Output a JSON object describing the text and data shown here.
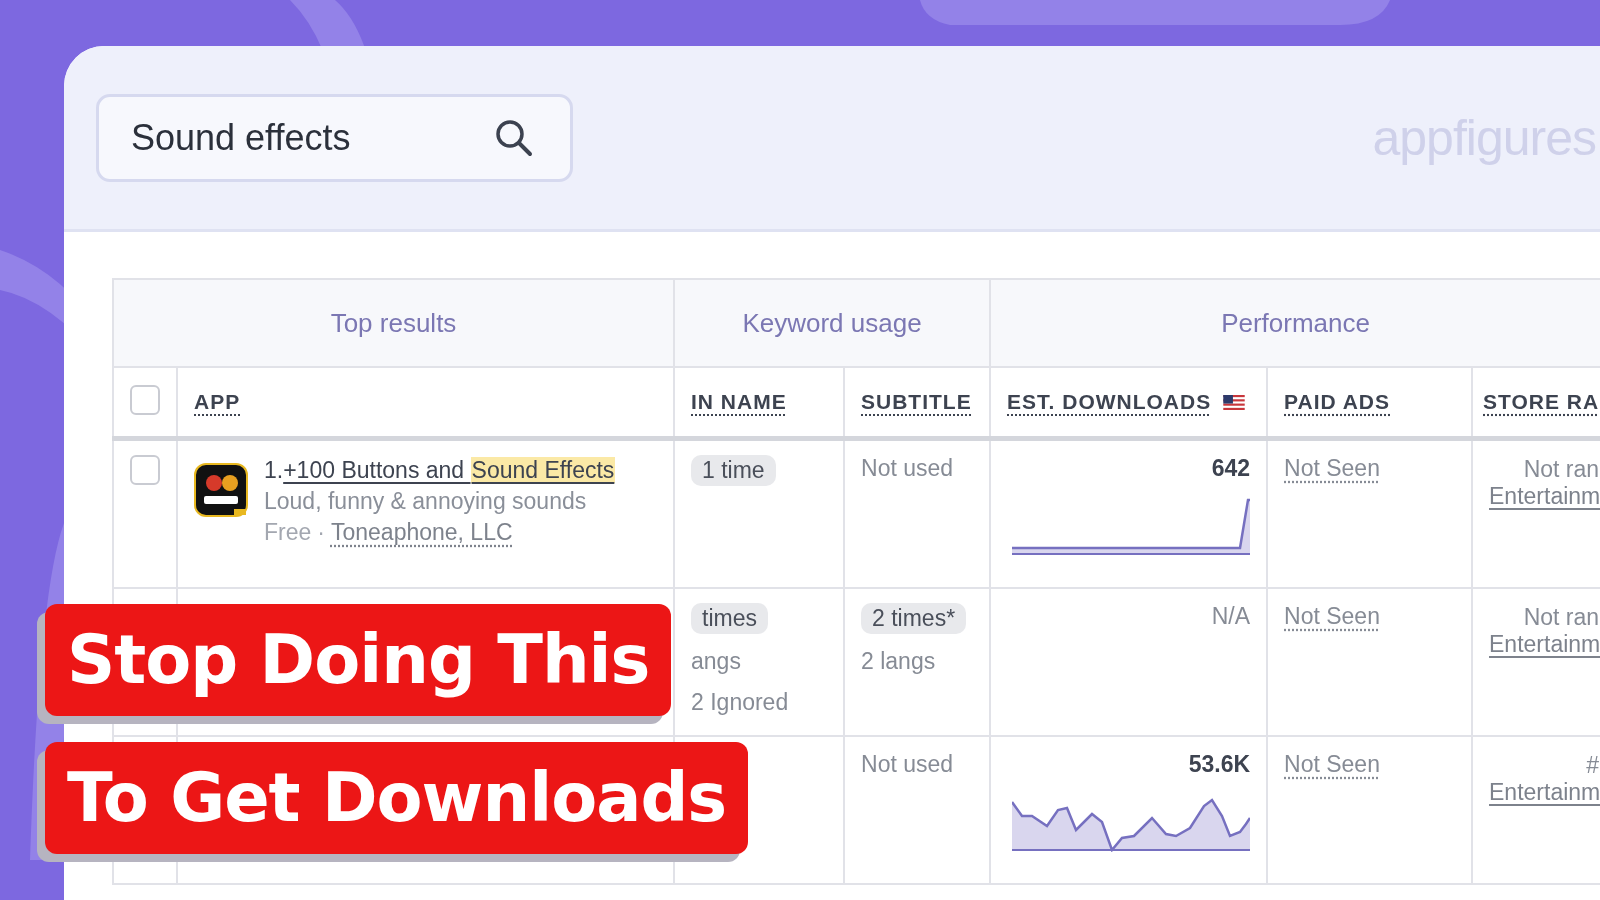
{
  "search": {
    "value": "Sound effects"
  },
  "logo": "appfigures",
  "table": {
    "groups": [
      {
        "label": "Top results"
      },
      {
        "label": "Keyword usage"
      },
      {
        "label": "Performance"
      }
    ],
    "select_all": {
      "checked": false
    },
    "columns": [
      {
        "label": "APP",
        "kind": "plain"
      },
      {
        "label": "IN NAME",
        "kind": "plain"
      },
      {
        "label": "SUBTITLE",
        "kind": "plain"
      },
      {
        "label": "EST. DOWNLOADS",
        "kind": "flagged"
      },
      {
        "label": "PAID ADS",
        "kind": "plain"
      },
      {
        "label": "STORE RA",
        "kind": "plain"
      }
    ],
    "rows": [
      {
        "checkbox": {
          "checked": false
        },
        "app": {
          "rank": "1.",
          "name": "+100 Buttons and ",
          "name_highlight": "Sound Effects",
          "subtitle": "Loud, funny & annoying sounds",
          "price": "Free",
          "separator": "·",
          "developer": "Toneaphone, LLC"
        },
        "in_name": {
          "badge": "1 time"
        },
        "subtitle_usage": {
          "text": "Not used"
        },
        "downloads": {
          "value": "642",
          "muted": false
        },
        "paid_ads": "Not Seen",
        "store_rank": {
          "rank": "Not ran",
          "category": "Entertainm"
        }
      },
      {
        "in_name": {
          "badge": "times",
          "lines": [
            "angs",
            "2 Ignored"
          ]
        },
        "subtitle_usage": {
          "badge": "2 times*",
          "lines": [
            "2 langs"
          ]
        },
        "downloads": {
          "value": "N/A",
          "muted": true
        },
        "paid_ads": "Not Seen",
        "store_rank": {
          "rank": "Not ran",
          "category": "Entertainm"
        }
      },
      {
        "in_name": {},
        "subtitle_usage": {
          "text": "Not used"
        },
        "downloads": {
          "value": "53.6K",
          "muted": false
        },
        "paid_ads": "Not Seen",
        "store_rank": {
          "rank": "#",
          "category": "Entertainm"
        }
      }
    ]
  },
  "banners": [
    {
      "text": "Stop Doing This"
    },
    {
      "text": "To Get Downloads"
    }
  ]
}
